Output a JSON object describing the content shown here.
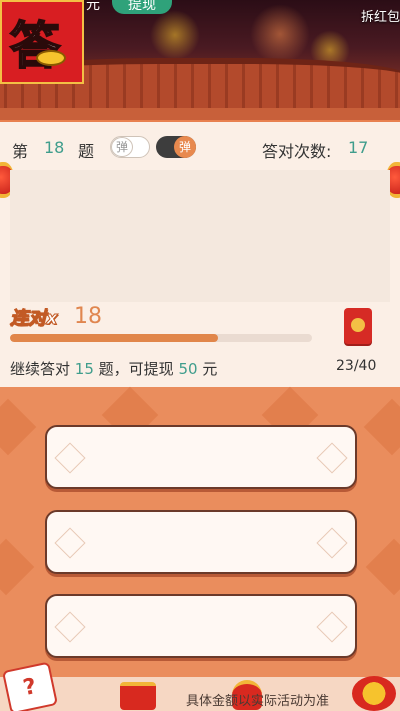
{
  "header": {
    "logo_char": "答",
    "cut_text": "元",
    "withdraw_label": "提现",
    "right_text": "拆红包"
  },
  "question": {
    "prefix": "第",
    "number": "18",
    "suffix": "题",
    "toggle_off_label": "弹",
    "toggle_on_label": "弹",
    "correct_label": "答对次数:",
    "correct_count": "17"
  },
  "streak": {
    "label": "连对x",
    "count": "18",
    "progress_fraction": 0.69
  },
  "reward": {
    "text_before": "继续答对",
    "remaining": "15",
    "text_middle": "题，可提现",
    "amount": "50",
    "text_after": "元",
    "progress_current": "23",
    "progress_total": "40"
  },
  "answers": [
    "",
    "",
    ""
  ],
  "footer": {
    "question_mark": "?",
    "disclaimer": "具体金额以实际活动为准"
  },
  "colors": {
    "accent_green": "#3f9d8c",
    "accent_orange": "#e1864a",
    "bg_orange": "#ea8d5d"
  }
}
